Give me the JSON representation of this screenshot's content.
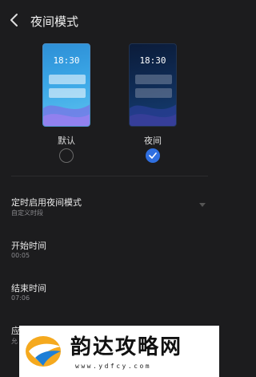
{
  "header": {
    "title": "夜间模式",
    "back_icon": "chevron-left-icon"
  },
  "modes": [
    {
      "label": "默认",
      "clock": "18:30",
      "selected": false
    },
    {
      "label": "夜间",
      "clock": "18:30",
      "selected": true
    }
  ],
  "settings": [
    {
      "title": "定时启用夜间模式",
      "subtitle": "自定义时段"
    },
    {
      "title": "开始时间",
      "subtitle": "00:05"
    },
    {
      "title": "结束时间",
      "subtitle": "07:06"
    },
    {
      "title": "应",
      "subtitle": "允"
    }
  ],
  "watermark": {
    "text": "韵达攻略网",
    "url": "www.ydfcy.com"
  },
  "colors": {
    "background": "#1c1c1e",
    "accent": "#2f6fe0",
    "divider": "#2c2c2e"
  }
}
